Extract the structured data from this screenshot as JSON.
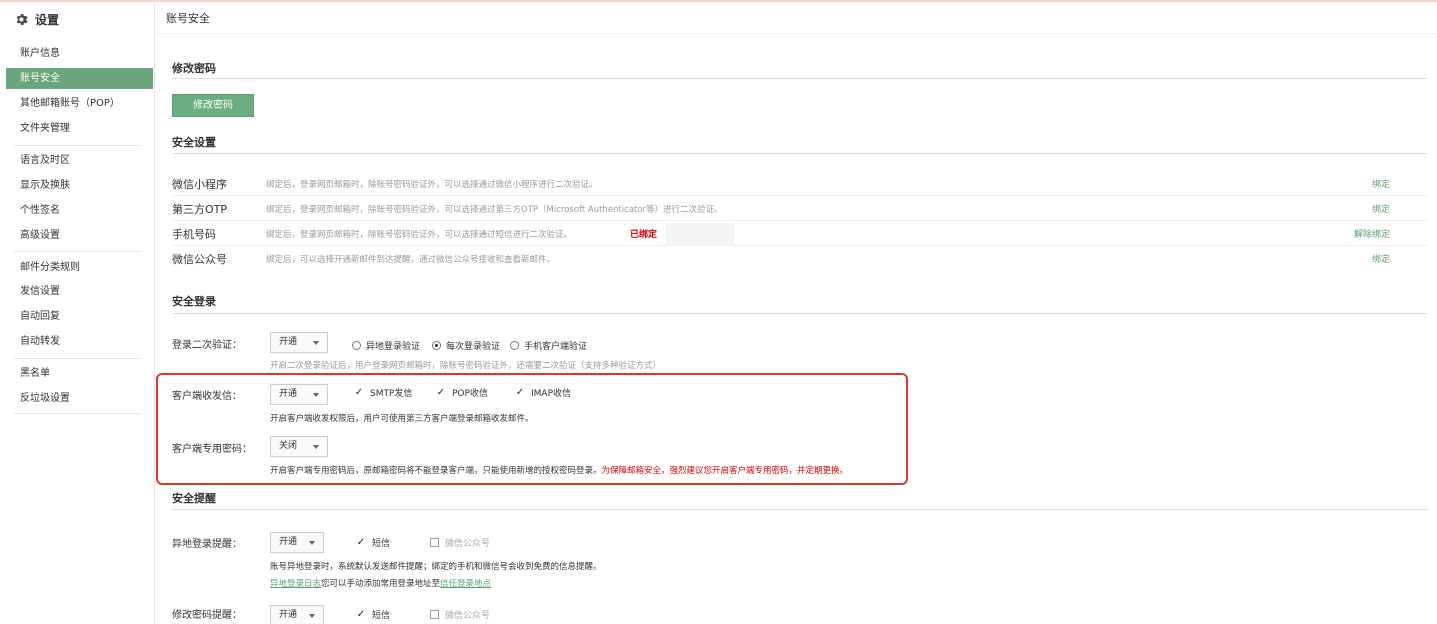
{
  "sidebar": {
    "title": "设置",
    "items": [
      {
        "label": "账户信息"
      },
      {
        "label": "账号安全"
      },
      {
        "label": "其他邮箱账号（POP）"
      },
      {
        "label": "文件夹管理"
      },
      {
        "label": "语言及时区"
      },
      {
        "label": "显示及换肤"
      },
      {
        "label": "个性签名"
      },
      {
        "label": "高级设置"
      },
      {
        "label": "邮件分类规则"
      },
      {
        "label": "发信设置"
      },
      {
        "label": "自动回复"
      },
      {
        "label": "自动转发"
      },
      {
        "label": "黑名单"
      },
      {
        "label": "反垃圾设置"
      }
    ]
  },
  "page": {
    "title": "账号安全"
  },
  "password": {
    "heading": "修改密码",
    "button": "修改密码"
  },
  "security_settings": {
    "heading": "安全设置",
    "rows": [
      {
        "label": "微信小程序",
        "desc": "绑定后，登录网页邮箱时，除账号密码验证外，可以选择通过微信小程序进行二次验证。",
        "action": "绑定"
      },
      {
        "label": "第三方OTP",
        "desc": "绑定后，登录网页邮箱时，除账号密码验证外，可以选择通过第三方OTP（Microsoft Authenticator等）进行二次验证。",
        "action": "绑定"
      },
      {
        "label": "手机号码",
        "desc": "绑定后，登录网页邮箱时，除账号密码验证外，可以选择通过短信进行二次验证。",
        "status": "已绑定",
        "action": "解除绑定"
      },
      {
        "label": "微信公众号",
        "desc": "绑定后，可以选择开通新邮件到达提醒，通过微信公众号接收和查看新邮件。",
        "action": "绑定"
      }
    ]
  },
  "secure_login": {
    "heading": "安全登录",
    "two_step": {
      "label": "登录二次验证：",
      "select": "开通",
      "options": [
        {
          "label": "异地登录验证",
          "checked": false
        },
        {
          "label": "每次登录验证",
          "checked": true
        },
        {
          "label": "手机客户端验证",
          "checked": false
        }
      ],
      "hint": "开启二次登录验证后，用户登录网页邮箱时，除账号密码验证外，还需要二次验证（支持多种验证方式）"
    },
    "client_send": {
      "label": "客户端收发信：",
      "select": "开通",
      "options": [
        {
          "label": "SMTP发信",
          "checked": true
        },
        {
          "label": "POP收信",
          "checked": true
        },
        {
          "label": "IMAP收信",
          "checked": true
        }
      ],
      "hint": "开启客户端收发权限后，用户可使用第三方客户端登录邮箱收发邮件。"
    },
    "client_password": {
      "label": "客户端专用密码：",
      "select": "关闭",
      "hint": "开启客户端专用密码后，原邮箱密码将不能登录客户端，只能使用新增的授权密码登录。",
      "warning": "为保障邮箱安全，强烈建议您开启客户端专用密码，并定期更换。"
    }
  },
  "alerts": {
    "heading": "安全提醒",
    "remote_login": {
      "label": "异地登录提醒：",
      "select": "开通",
      "options": [
        {
          "label": "短信",
          "checked": true,
          "disabled": false
        },
        {
          "label": "微信公众号",
          "checked": false,
          "disabled": true
        }
      ],
      "hint": "账号异地登录时，系统默认发送邮件提醒；绑定的手机和微信号会收到免费的信息提醒。",
      "log_link": "异地登录日志",
      "log_text": "您可以手动添加常用登录地址至",
      "trusted_link": "信任登录地点"
    },
    "password_change": {
      "label": "修改密码提醒：",
      "select": "开通",
      "options": [
        {
          "label": "短信",
          "checked": true,
          "disabled": false
        },
        {
          "label": "微信公众号",
          "checked": false,
          "disabled": true
        }
      ]
    }
  },
  "colors": {
    "accent": "#68a57a",
    "link": "#5b9e6c",
    "warning": "#dd0000",
    "highlight_border": "#d93a2b"
  }
}
